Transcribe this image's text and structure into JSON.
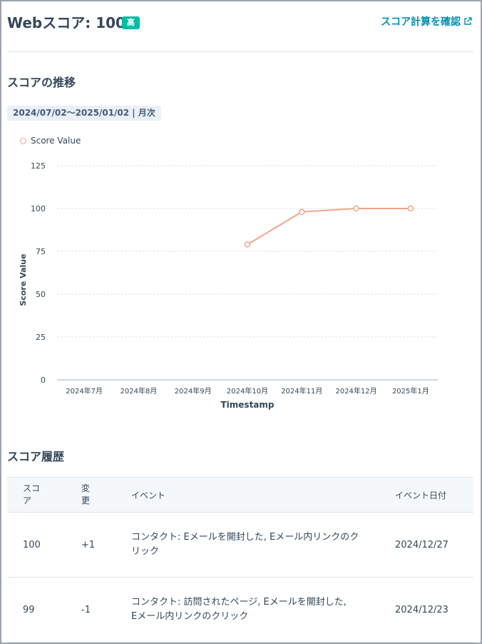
{
  "header": {
    "title": "Webスコア: 100",
    "badge": "高",
    "calc_link": "スコア計算を確認",
    "calc_link_icon": "external-link-icon"
  },
  "trend": {
    "title": "スコアの推移",
    "range": "2024/07/02〜2025/01/02 | 月次"
  },
  "chart_data": {
    "type": "line",
    "legend": [
      "Score Value"
    ],
    "legend_position": "top-left",
    "xlabel": "Timestamp",
    "ylabel": "Score Value",
    "categories": [
      "2024年7月",
      "2024年8月",
      "2024年9月",
      "2024年10月",
      "2024年11月",
      "2024年12月",
      "2025年1月"
    ],
    "series": [
      {
        "name": "Score Value",
        "values": [
          null,
          null,
          null,
          79,
          98,
          100,
          100
        ],
        "color": "#f2a488"
      }
    ],
    "ylim": [
      0,
      125
    ],
    "yticks": [
      0,
      25,
      50,
      75,
      100,
      125
    ],
    "grid": true
  },
  "history": {
    "title": "スコア履歴",
    "headers": {
      "score": "スコア",
      "change": "変更",
      "event": "イベント",
      "date": "イベント日付"
    },
    "rows": [
      {
        "score": "100",
        "change": "+1",
        "event": "コンタクト: Eメールを開封した, Eメール内リンクのクリック",
        "date": "2024/12/27"
      },
      {
        "score": "99",
        "change": "-1",
        "event": "コンタクト: 訪問されたページ, Eメールを開封した, Eメール内リンクのクリック",
        "date": "2024/12/23"
      }
    ]
  },
  "colors": {
    "badge": "#00bda5",
    "link": "#0091ae",
    "line": "#f2a488",
    "text": "#33475b"
  }
}
